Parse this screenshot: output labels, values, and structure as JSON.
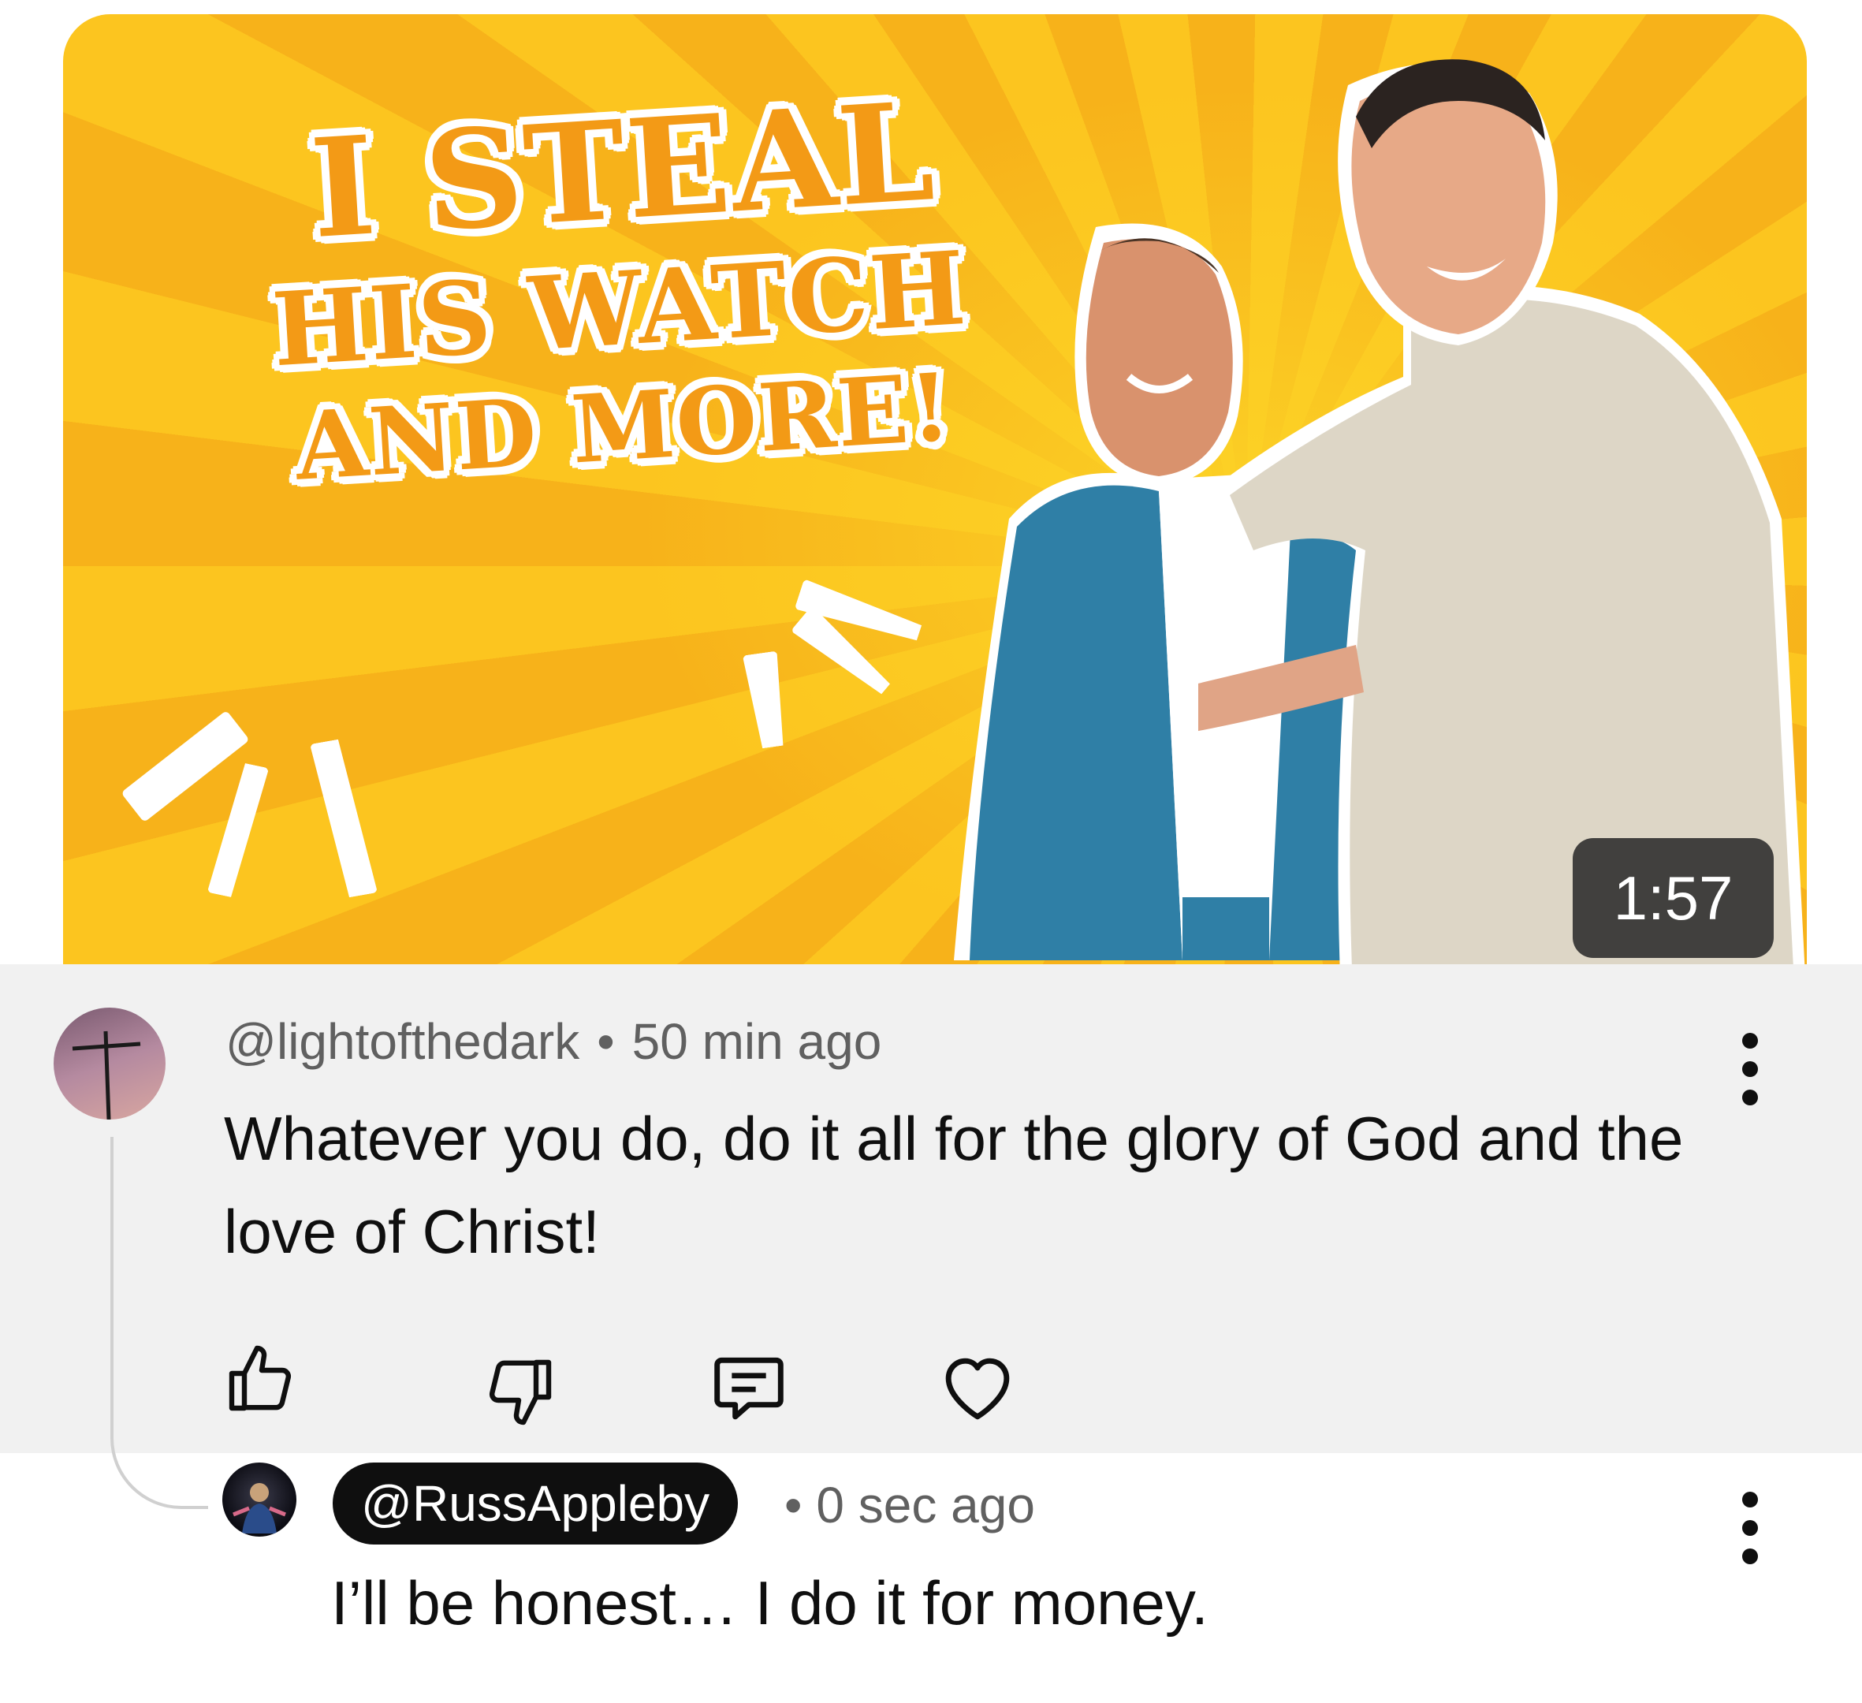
{
  "thumbnail": {
    "headline_line1": "I STEAL",
    "headline_line2": "HIS WATCH",
    "headline_line3": "AND MORE!",
    "duration": "1:57"
  },
  "comment": {
    "author": "@lightofthedark",
    "separator": "•",
    "time": "50 min ago",
    "text": "Whatever you do, do it all for the glory of God and the love of Christ!",
    "actions": [
      "like-icon",
      "dislike-icon",
      "reply-icon",
      "heart-icon"
    ]
  },
  "reply": {
    "author": "@RussAppleby",
    "separator": "•",
    "time": "0 sec ago",
    "text": "I’ll be honest… I do it for money."
  },
  "colors": {
    "thumbnail_bg": "#fbc31e",
    "headline_orange": "#f39a16",
    "comment_highlight": "#f1f1f1",
    "mention_pill": "#0f0f0f"
  }
}
